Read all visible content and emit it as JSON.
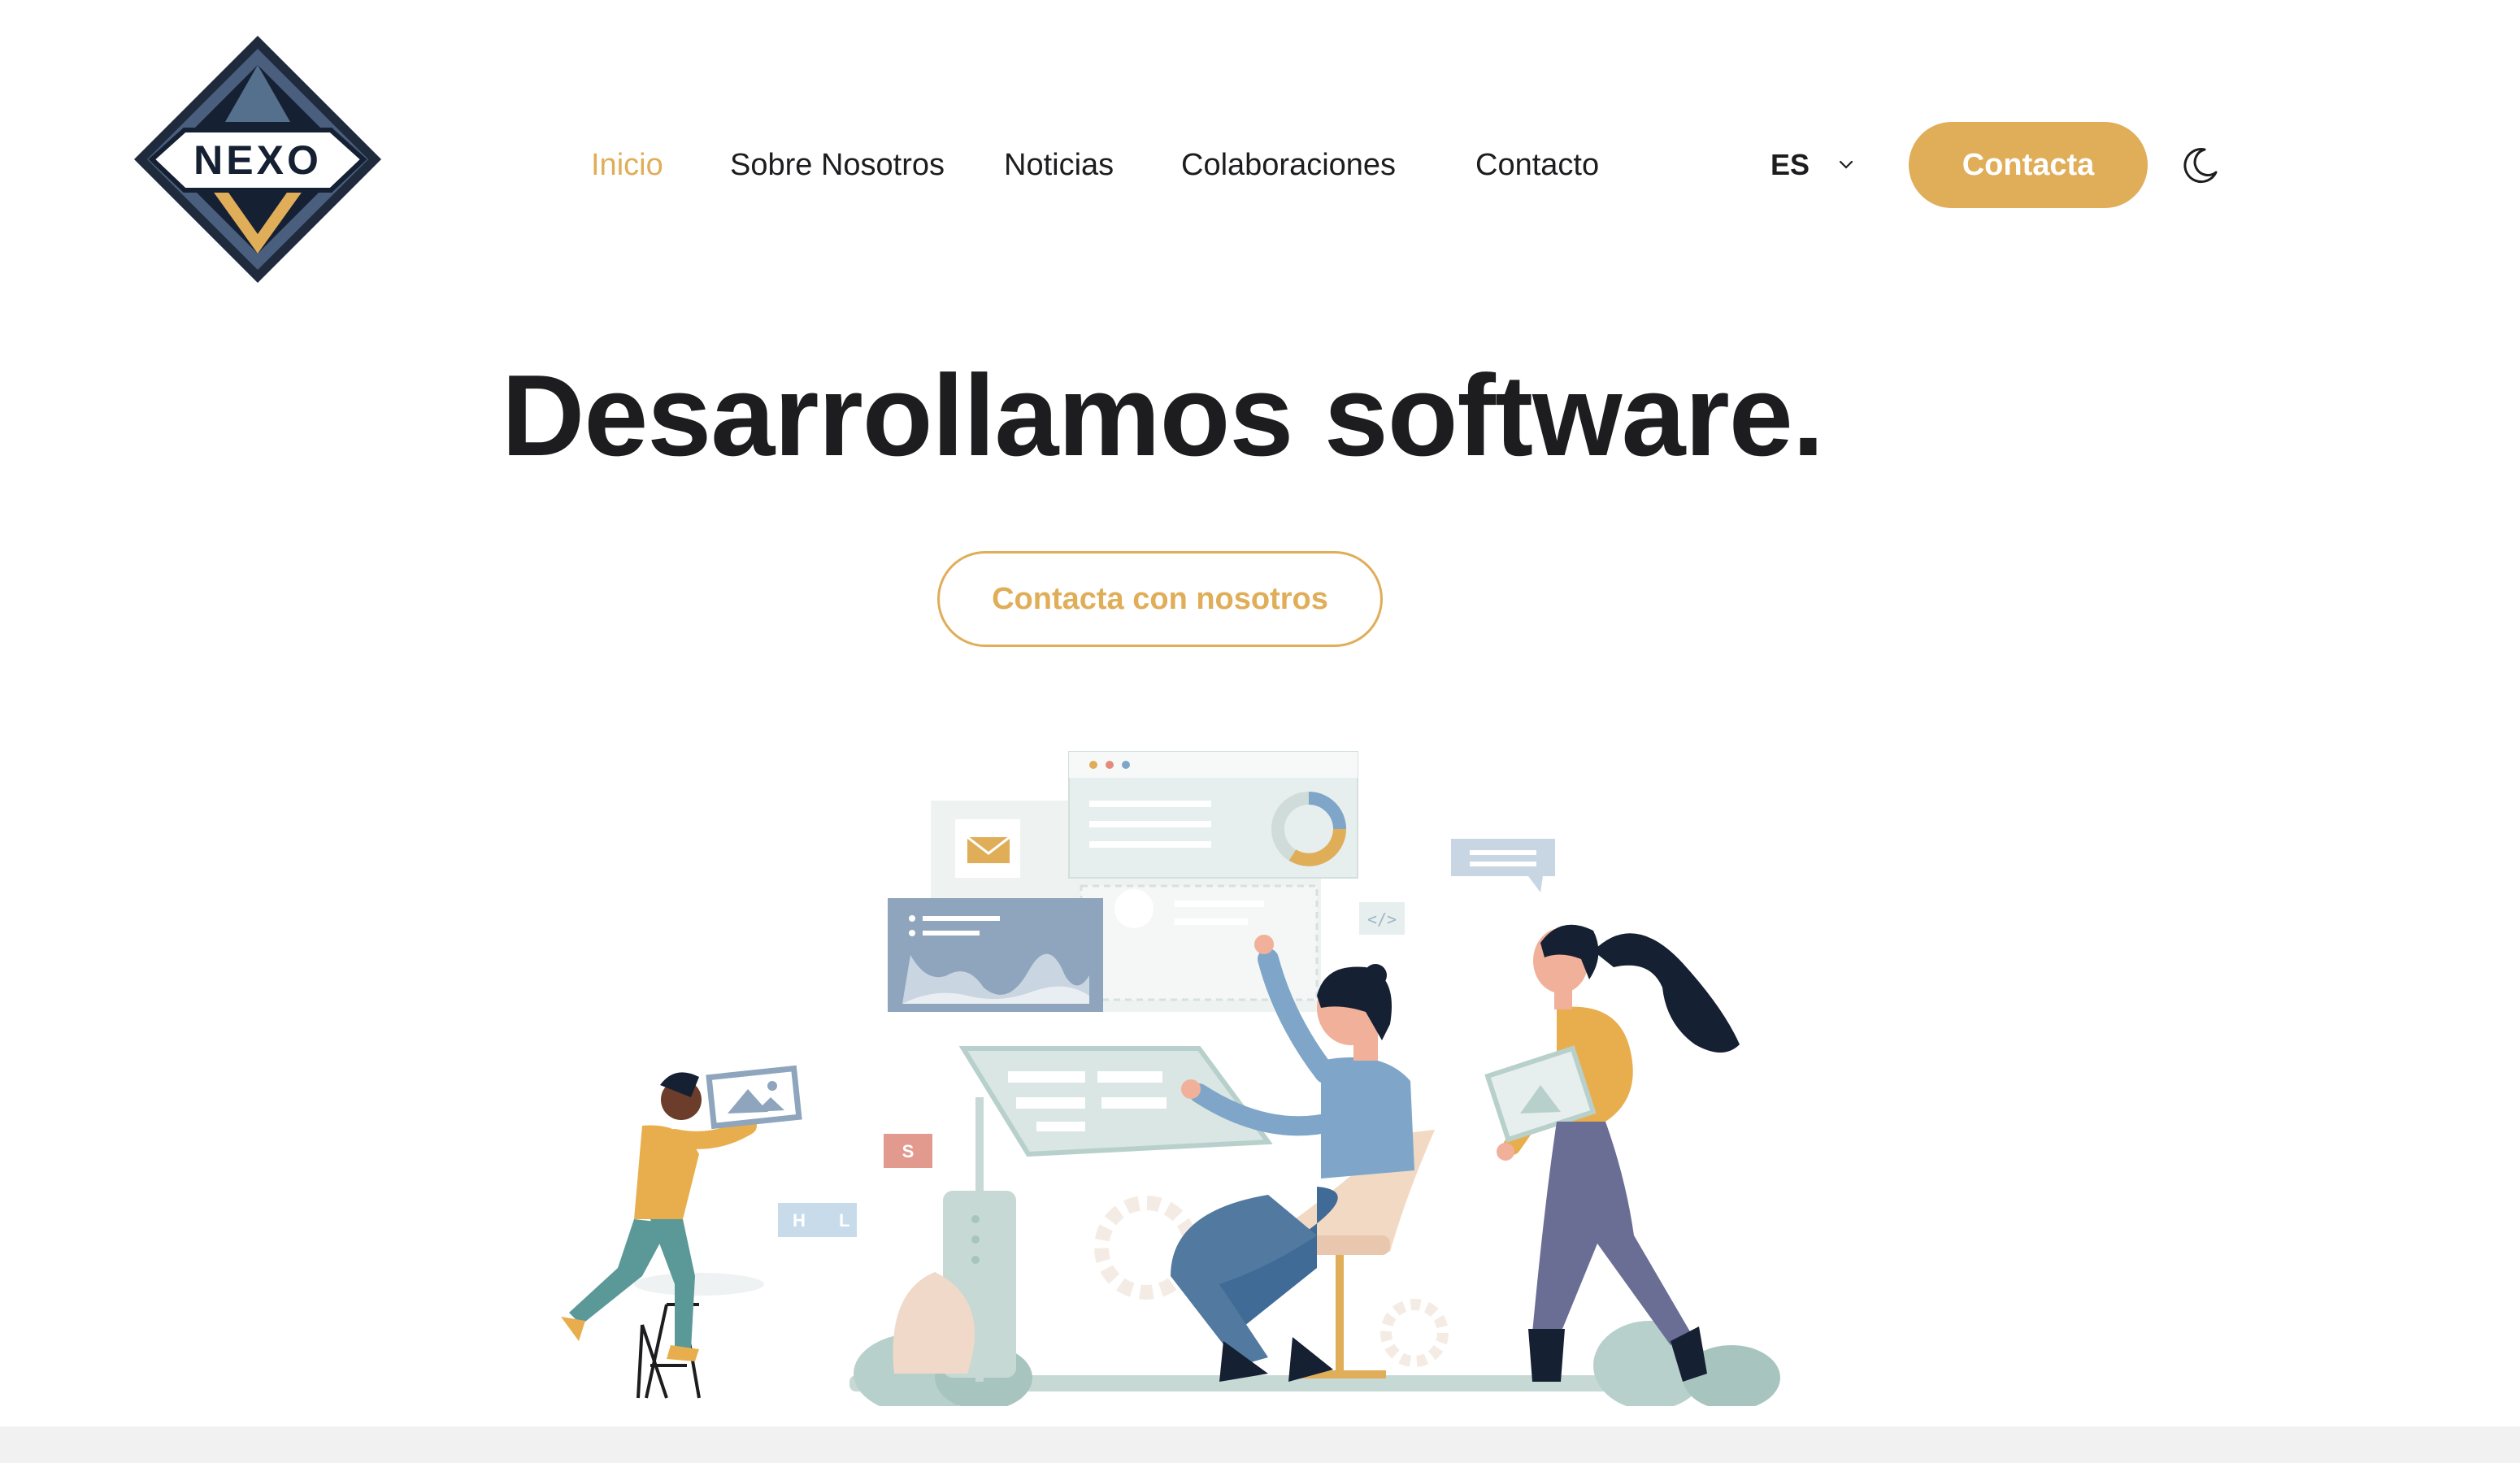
{
  "brand": {
    "logo_text": "NEXO"
  },
  "nav": {
    "items": [
      {
        "label": "Inicio",
        "active": true
      },
      {
        "label": "Sobre Nosotros",
        "active": false
      },
      {
        "label": "Noticias",
        "active": false
      },
      {
        "label": "Colaboraciones",
        "active": false
      },
      {
        "label": "Contacto",
        "active": false
      }
    ]
  },
  "language": {
    "selected": "ES",
    "icon": "chevron-down-icon"
  },
  "header_cta": {
    "label": "Contacta"
  },
  "theme_toggle": {
    "icon": "moon-icon"
  },
  "hero": {
    "title": "Desarrollamos software.",
    "button_label": "Contacta con nosotros"
  },
  "illustration": {
    "tiles": {
      "s": "S",
      "h": "H",
      "l": "L"
    },
    "code_tag": "</>"
  },
  "colors": {
    "accent": "#e0ad58",
    "text": "#1d1d1f",
    "navy": "#14213d",
    "blue": "#7fa6c8",
    "sage": "#b8d0cb"
  }
}
